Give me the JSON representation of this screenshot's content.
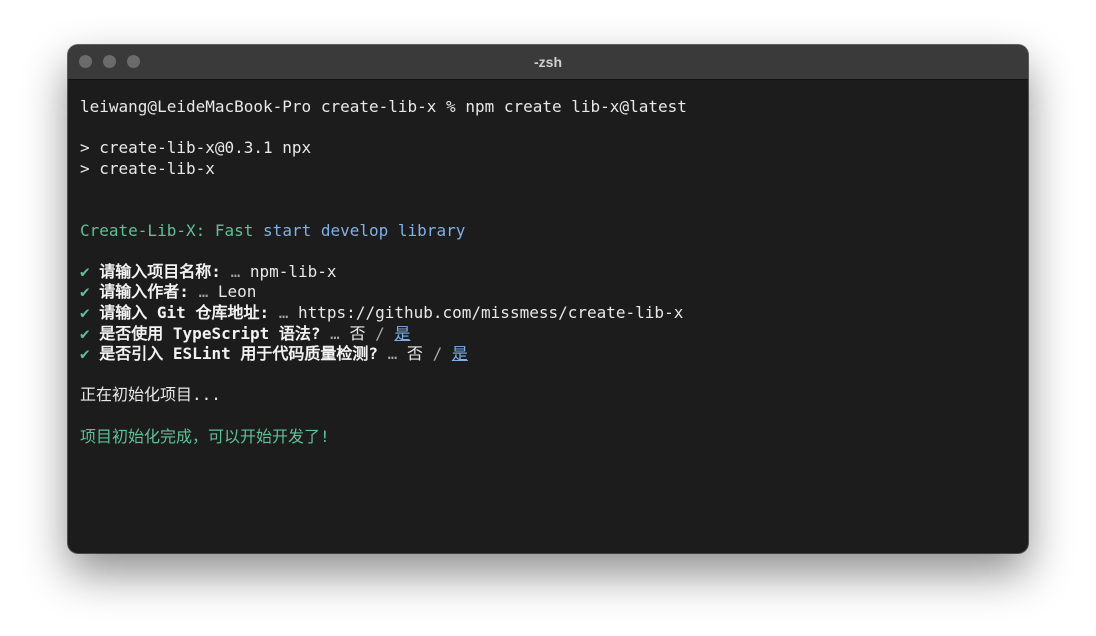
{
  "window": {
    "title": "-zsh"
  },
  "terminal": {
    "prompt": "leiwang@LeideMacBook-Pro create-lib-x % npm create lib-x@latest",
    "npx_line1": "> create-lib-x@0.3.1 npx",
    "npx_line2": "> create-lib-x",
    "banner": {
      "name": "Create-Lib-X:",
      "fast": "Fast",
      "rest": "start develop library"
    },
    "questions": [
      {
        "check": "✔",
        "label": "请输入项目名称:",
        "ellipsis": "…",
        "answer": "npm-lib-x"
      },
      {
        "check": "✔",
        "label": "请输入作者:",
        "ellipsis": "…",
        "answer": "Leon"
      },
      {
        "check": "✔",
        "label": "请输入 Git 仓库地址:",
        "ellipsis": "…",
        "answer": "https://github.com/missmess/create-lib-x"
      },
      {
        "check": "✔",
        "label": "是否使用 TypeScript 语法?",
        "ellipsis": "…",
        "no": "否",
        "sep": "/",
        "yes": "是"
      },
      {
        "check": "✔",
        "label": "是否引入 ESLint 用于代码质量检测?",
        "ellipsis": "…",
        "no": "否",
        "sep": "/",
        "yes": "是"
      }
    ],
    "initializing": "正在初始化项目...",
    "done": "项目初始化完成，可以开始开发了!"
  },
  "colors": {
    "terminal_bg": "#1c1c1c",
    "accent_green": "#5fc095",
    "accent_blue": "#7fb0e6"
  }
}
